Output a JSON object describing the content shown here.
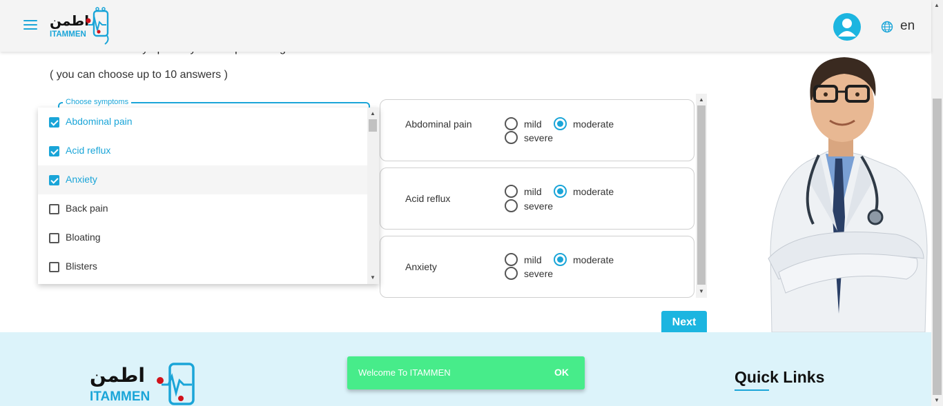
{
  "header": {
    "brand_arabic": "اطمن",
    "brand_latin": "ITAMMEN",
    "language": "en"
  },
  "question": {
    "title": "Please select the symptoms you're experiencing?",
    "subtitle": "( you can choose up to 10 answers )"
  },
  "symptom_select": {
    "legend": "Choose symptoms",
    "options": [
      {
        "label": "Abdominal pain",
        "checked": true
      },
      {
        "label": "Acid reflux",
        "checked": true
      },
      {
        "label": "Anxiety",
        "checked": true
      },
      {
        "label": "Back pain",
        "checked": false
      },
      {
        "label": "Bloating",
        "checked": false
      },
      {
        "label": "Blisters",
        "checked": false
      }
    ]
  },
  "severity": {
    "levels": [
      "mild",
      "moderate",
      "severe"
    ],
    "items": [
      {
        "label": "Abdominal pain",
        "selected": "moderate"
      },
      {
        "label": "Acid reflux",
        "selected": "moderate"
      },
      {
        "label": "Anxiety",
        "selected": "moderate"
      }
    ]
  },
  "next_label": "Next",
  "footer": {
    "brand_arabic": "اطمن",
    "brand_latin": "ITAMMEN",
    "quick_links": "Quick Links"
  },
  "snackbar": {
    "message": "Welcome To ITAMMEN",
    "action": "OK"
  },
  "colors": {
    "accent": "#1cb5e0",
    "snackbar": "#47ec8a",
    "footer_bg": "#dcf3fa"
  }
}
